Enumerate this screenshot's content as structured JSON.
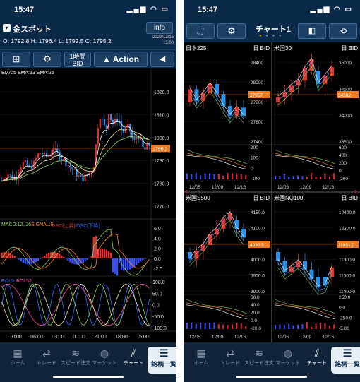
{
  "left_screen": {
    "status_time": "15:47",
    "symbol": "金スポット",
    "info_button": "info",
    "quote": {
      "o": "O: 1792.8",
      "h": "H: 1796.4",
      "l": "L: 1792.5",
      "c": "C: 1795.2"
    },
    "date": "2022/12/15",
    "time": "15:00",
    "timeframe_line1": "1時間",
    "timeframe_line2": "BID",
    "action_label": "Action",
    "ema_label": "EMA:5 EMA:13 EMA:25",
    "price_ticks": [
      "1820.0",
      "1810.0",
      "1800.0",
      "1795.2",
      "1790.0",
      "1780.0",
      "1770.0"
    ],
    "current_price": "1795.2",
    "macd_label": "MACD:12, 26",
    "signal_label": "SIGNAL:9",
    "osc_up_label": "OSC(上昇)",
    "osc_down_label": "OSC(下降)",
    "macd_ticks": [
      "6.0",
      "4.0",
      "2.0",
      "0.0",
      "-2.0"
    ],
    "rci_label": "RCI:9",
    "rci2_label": "RCI:52",
    "rci_ticks": [
      "100.0",
      "50.0",
      "0.0",
      "-50.0",
      "-100.0"
    ],
    "time_ticks": [
      "10:00",
      "06:00",
      "03:00",
      "00:00",
      "21:00",
      "18:00",
      "15:00"
    ]
  },
  "right_screen": {
    "status_time": "15:47",
    "title": "チャート1",
    "charts": [
      {
        "name": "日本225",
        "bid": "日 BID",
        "ticks": [
          "28400",
          "28000",
          "27957",
          "27800",
          "27600",
          "27400"
        ],
        "current": "27957",
        "ind_ticks": [
          "200",
          "100",
          "0",
          "-100"
        ],
        "dates": [
          "12/05",
          "12/09",
          "12/15"
        ]
      },
      {
        "name": "米国30",
        "bid": "日 BID",
        "ticks": [
          "35000",
          "34500",
          "34262",
          "34000",
          "33500"
        ],
        "current": "34262",
        "ind_ticks": [
          "600",
          "400",
          "200",
          "0",
          "-200"
        ],
        "dates": [
          "12/05",
          "12/09",
          "12/15"
        ]
      },
      {
        "name": "米国S500",
        "bid": "日 BID",
        "ticks": [
          "4150.0",
          "4100.0",
          "4050.0",
          "4030.5",
          "4000.0",
          "3950.0",
          "3900.0"
        ],
        "current": "4030.5",
        "ind_ticks": [
          "60.0",
          "40.0",
          "20.0",
          "0.0",
          "-20.0"
        ],
        "dates": [
          "12/05",
          "12/09",
          "12/15"
        ]
      },
      {
        "name": "米国NQ100",
        "bid": "日 BID",
        "ticks": [
          "12400.0",
          "12200.0",
          "12000.0",
          "11851.0",
          "11800.0",
          "11600.0",
          "11400.0"
        ],
        "current": "11851.0",
        "ind_ticks": [
          "250.0",
          "0.0",
          "-250.0",
          "-5.00"
        ],
        "dates": [
          "12/05",
          "12/09",
          "12/15"
        ]
      }
    ]
  },
  "tabs": [
    {
      "label": "ホーム",
      "icon": "grid-icon"
    },
    {
      "label": "トレード",
      "icon": "refresh-icon"
    },
    {
      "label": "スピード注文",
      "icon": "speed-icon"
    },
    {
      "label": "マーケット",
      "icon": "globe-icon"
    },
    {
      "label": "チャート",
      "icon": "chart-icon"
    },
    {
      "label": "銘柄一覧",
      "icon": "list-icon"
    }
  ],
  "colors": {
    "header": "#0b2a4a",
    "price_tag": "#f07a20",
    "up": "#e03030",
    "down": "#2a90e8"
  }
}
